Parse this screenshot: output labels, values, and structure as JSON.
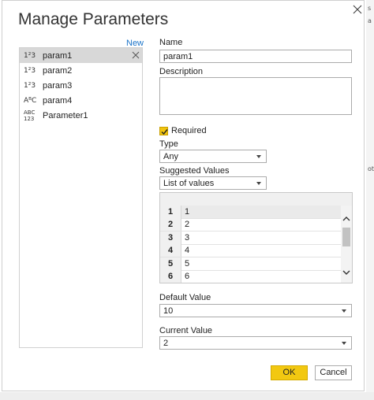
{
  "dialog": {
    "title": "Manage Parameters",
    "new_label": "New"
  },
  "params": [
    {
      "icon": "1²3",
      "name": "param1",
      "selected": true
    },
    {
      "icon": "1²3",
      "name": "param2"
    },
    {
      "icon": "1²3",
      "name": "param3"
    },
    {
      "icon": "AᴮC",
      "name": "param4"
    },
    {
      "icon": "ABC 123",
      "name": "Parameter1"
    }
  ],
  "form": {
    "name_label": "Name",
    "name_value": "param1",
    "description_label": "Description",
    "required_label": "Required",
    "type_label": "Type",
    "type_value": "Any",
    "suggested_label": "Suggested Values",
    "suggested_value": "List of values",
    "list_rows": [
      {
        "n": "1",
        "v": "1"
      },
      {
        "n": "2",
        "v": "2"
      },
      {
        "n": "3",
        "v": "3"
      },
      {
        "n": "4",
        "v": "4"
      },
      {
        "n": "5",
        "v": "5"
      },
      {
        "n": "6",
        "v": "6"
      }
    ],
    "default_label": "Default Value",
    "default_value": "10",
    "current_label": "Current Value",
    "current_value": "2"
  },
  "buttons": {
    "ok": "OK",
    "cancel": "Cancel"
  },
  "colors": {
    "accent": "#f2c811",
    "link": "#1a73c8"
  }
}
